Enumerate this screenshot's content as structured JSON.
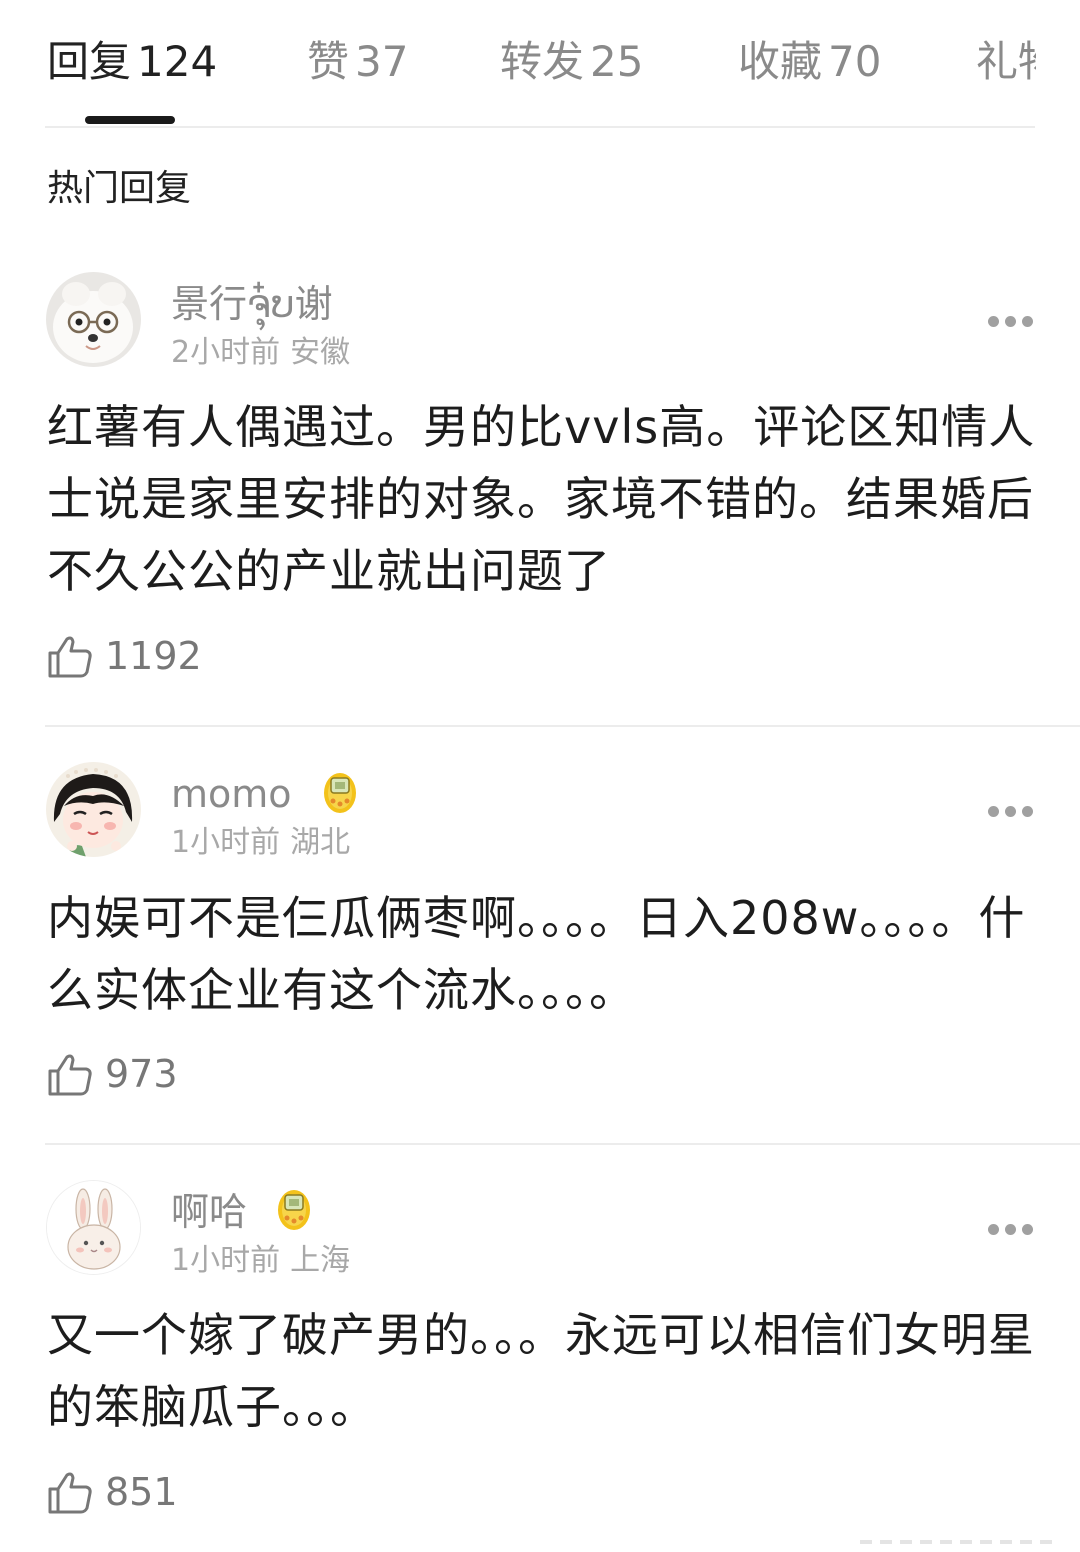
{
  "tabs": [
    {
      "label": "回复",
      "count": "124"
    },
    {
      "label": "赞",
      "count": "37"
    },
    {
      "label": "转发",
      "count": "25"
    },
    {
      "label": "收藏",
      "count": "70"
    },
    {
      "label": "礼物",
      "count": ""
    }
  ],
  "section_title": "热门回复",
  "comments": [
    {
      "username": "景行ຈຸ໋ບ谢",
      "time": "2小时前",
      "location": "安徽",
      "text": "红薯有人偶遇过。男的比vvls高。评论区知情人士说是家里安排的对象。家境不错的。结果婚后不久公公的产业就出问题了",
      "likes": "1192",
      "avatar_icon": "dog-with-glasses-avatar"
    },
    {
      "username": "momo",
      "time": "1小时前",
      "location": "湖北",
      "text": "内娱可不是仨瓜俩枣啊。。。。日入208w。。。。什么实体企业有这个流水。。。。",
      "likes": "973",
      "avatar_icon": "cartoon-girl-avatar",
      "badge_icon": "tamagotchi-badge-icon"
    },
    {
      "username": "啊哈",
      "time": "1小时前",
      "location": "上海",
      "text": "又一个嫁了破产男的。。。永远可以相信们女明星的笨脑瓜子。。。",
      "likes": "851",
      "avatar_icon": "bunny-avatar",
      "badge_icon": "tamagotchi-badge-icon"
    }
  ],
  "colors": {
    "text_primary": "#1d1d1d",
    "text_secondary": "#8a8a8a",
    "divider": "#ececec",
    "badge_yellow": "#f3c21b"
  }
}
